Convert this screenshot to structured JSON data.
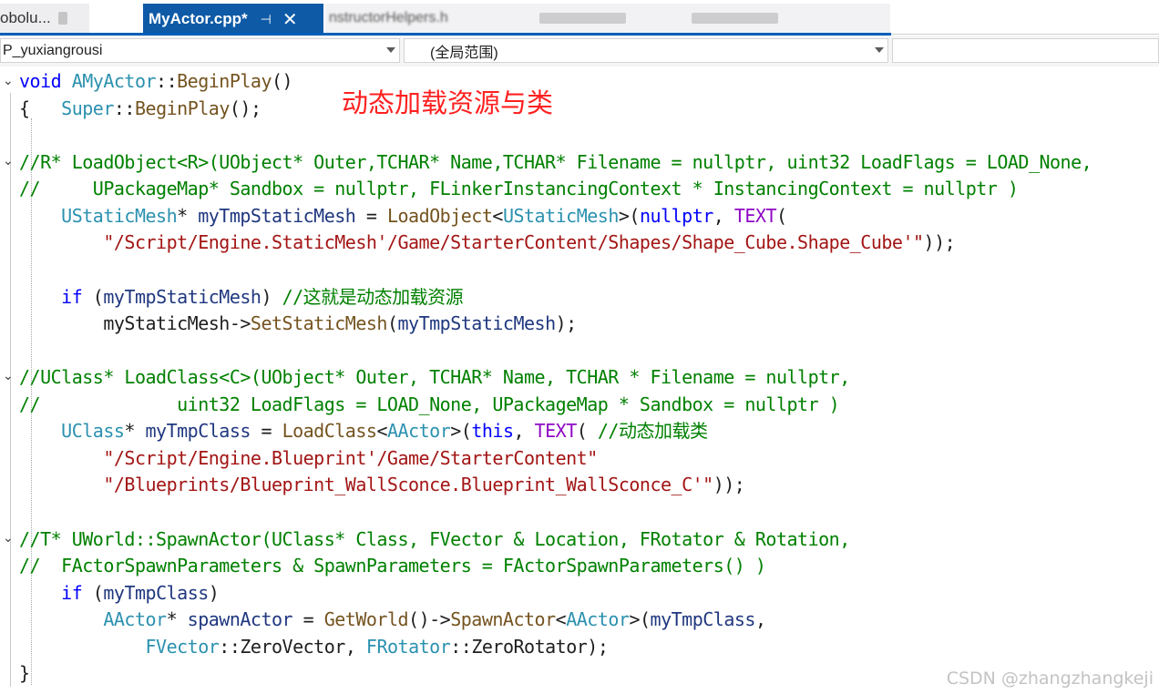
{
  "tabs": [
    {
      "label": "obolu...",
      "active": false
    },
    {
      "label": "MyActor.cpp*",
      "active": true,
      "pin_glyph": "⊣",
      "close_glyph": "✕"
    },
    {
      "label": "nstructorHelpers.h",
      "active": false
    }
  ],
  "navigation": {
    "project_dropdown": "P_yuxiangrousi",
    "scope_dropdown": "(全局范围)",
    "member_dropdown": ""
  },
  "annotation": "动态加载资源与类",
  "watermark": "CSDN @zhangzhangkeji",
  "code": {
    "l1": [
      "void",
      "AMyActor",
      "::",
      "BeginPlay",
      "()"
    ],
    "l2": [
      "{",
      "Super",
      "::",
      "BeginPlay",
      "();"
    ],
    "l4": "//R* LoadObject<R>(UObject* Outer,TCHAR* Name,TCHAR* Filename = nullptr, uint32 LoadFlags = LOAD_None,",
    "l5": "//     UPackageMap* Sandbox = nullptr, FLinkerInstancingContext * InstancingContext = nullptr )",
    "l6": [
      "UStaticMesh",
      "* ",
      "myTmpStaticMesh",
      " = ",
      "LoadObject",
      "<",
      "UStaticMesh",
      ">(",
      "nullptr",
      ", ",
      "TEXT",
      "("
    ],
    "l7": [
      "\"/Script/Engine.StaticMesh'/Game/StarterContent/Shapes/Shape_Cube.Shape_Cube'\"",
      "));"
    ],
    "l9": [
      "if",
      " (",
      "myTmpStaticMesh",
      ") ",
      "//这就是动态加载资源"
    ],
    "l10": [
      "myStaticMesh",
      "->",
      "SetStaticMesh",
      "(",
      "myTmpStaticMesh",
      ");"
    ],
    "l12": "//UClass* LoadClass<C>(UObject* Outer, TCHAR* Name, TCHAR * Filename = nullptr,",
    "l13": "//             uint32 LoadFlags = LOAD_None, UPackageMap * Sandbox = nullptr )",
    "l14": [
      "UClass",
      "* ",
      "myTmpClass",
      " = ",
      "LoadClass",
      "<",
      "AActor",
      ">(",
      "this",
      ", ",
      "TEXT",
      "( ",
      "//动态加载类"
    ],
    "l15": "\"/Script/Engine.Blueprint'/Game/StarterContent\"",
    "l16": [
      "\"/Blueprints/Blueprint_WallSconce.Blueprint_WallSconce_C'\"",
      "));"
    ],
    "l18": "//T* UWorld::SpawnActor(UClass* Class, FVector & Location, FRotator & Rotation,",
    "l19": "//  FActorSpawnParameters & SpawnParameters = FActorSpawnParameters() )",
    "l20": [
      "if",
      " (",
      "myTmpClass",
      ")"
    ],
    "l21": [
      "AActor",
      "* ",
      "spawnActor",
      " = ",
      "GetWorld",
      "()->",
      "SpawnActor",
      "<",
      "AActor",
      ">(",
      "myTmpClass",
      ","
    ],
    "l22": [
      "FVector",
      "::",
      "ZeroVector",
      ", ",
      "FRotator",
      "::",
      "ZeroRotator",
      ");"
    ],
    "l23": "}"
  },
  "colors": {
    "keyword": "#0000ff",
    "type": "#2b91af",
    "function": "#74531f",
    "comment": "#008000",
    "string": "#a31515",
    "macro": "#8f08c4",
    "variable": "#1f377f",
    "active_tab": "#0e5aa7",
    "annotation": "#ff2020"
  }
}
